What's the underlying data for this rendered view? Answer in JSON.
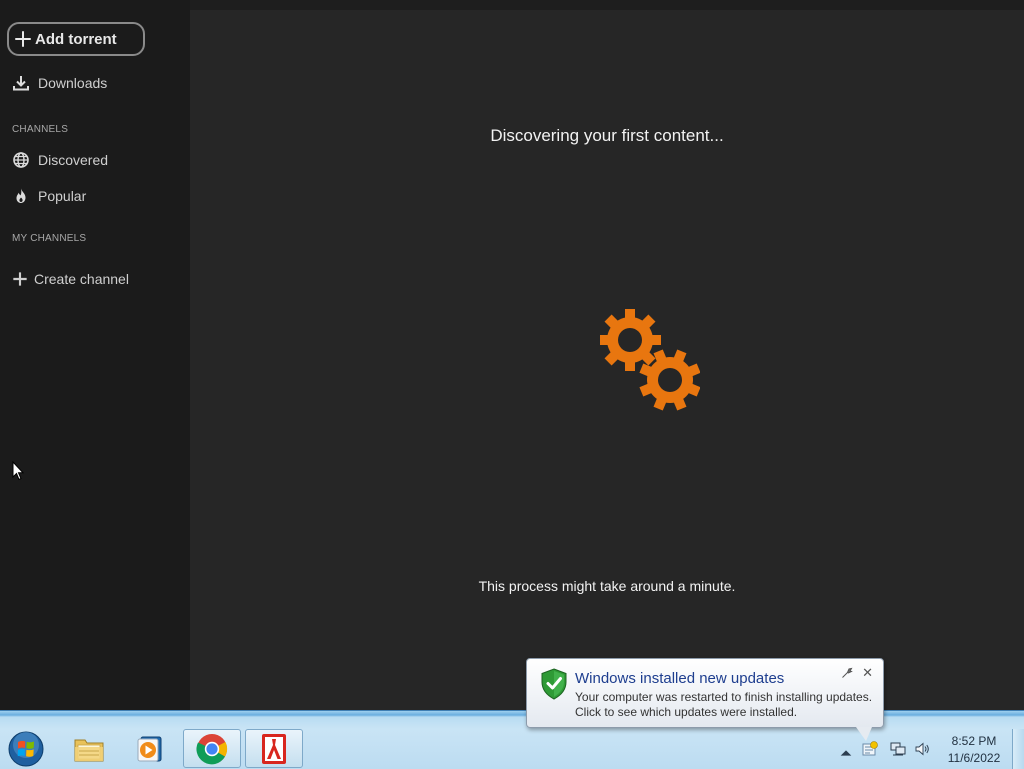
{
  "sidebar": {
    "add_torrent_label": "Add torrent",
    "downloads_label": "Downloads",
    "channels_title": "CHANNELS",
    "discovered_label": "Discovered",
    "popular_label": "Popular",
    "my_channels_title": "MY CHANNELS",
    "create_channel_label": "Create channel"
  },
  "main": {
    "title": "Discovering your first content...",
    "note": "This process might take around a minute.",
    "spinner_icon": "gears-icon",
    "accent_color": "#e8760f"
  },
  "notification": {
    "title": "Windows installed new updates",
    "line1": "Your computer was restarted to finish installing updates.",
    "line2": "Click to see which updates were installed.",
    "close_glyph": "✕"
  },
  "taskbar": {
    "pinned": [
      "windows-explorer",
      "media-player",
      "chrome",
      "app-red"
    ],
    "clock_time": "8:52 PM",
    "clock_date": "11/6/2022"
  }
}
